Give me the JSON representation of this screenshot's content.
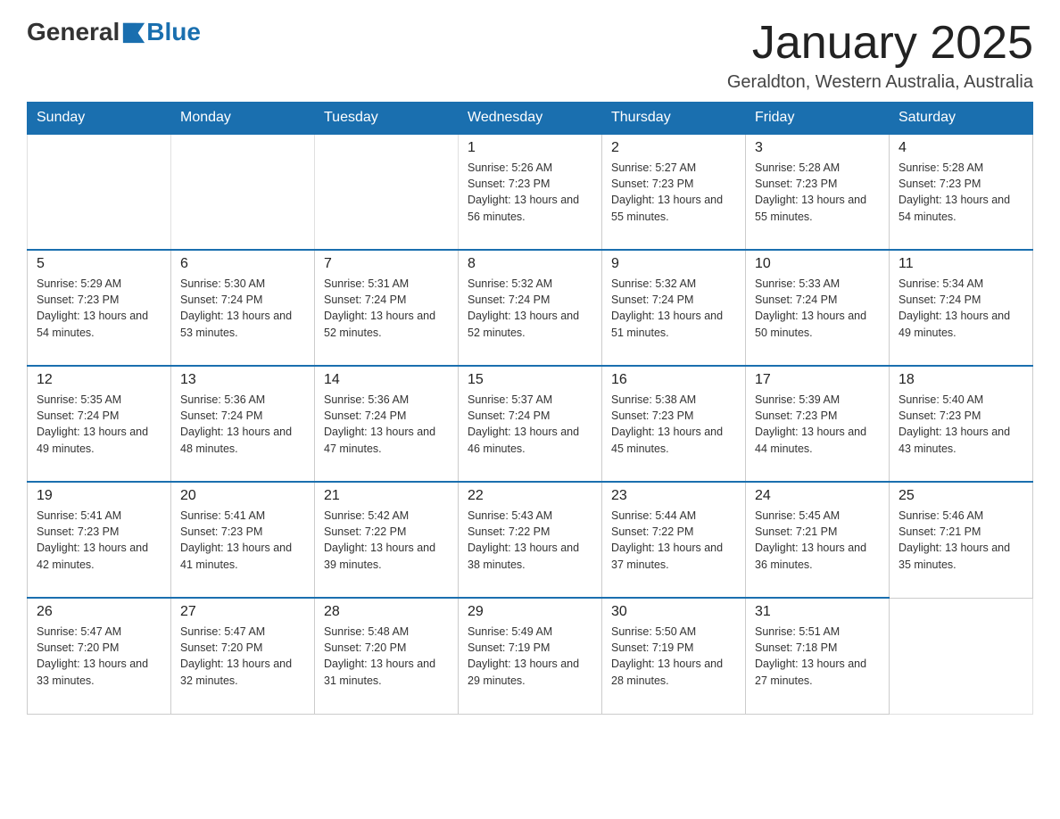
{
  "header": {
    "logo_general": "General",
    "logo_blue": "Blue",
    "title": "January 2025",
    "subtitle": "Geraldton, Western Australia, Australia"
  },
  "days_of_week": [
    "Sunday",
    "Monday",
    "Tuesday",
    "Wednesday",
    "Thursday",
    "Friday",
    "Saturday"
  ],
  "weeks": [
    {
      "days": [
        {
          "number": "",
          "info": ""
        },
        {
          "number": "",
          "info": ""
        },
        {
          "number": "",
          "info": ""
        },
        {
          "number": "1",
          "info": "Sunrise: 5:26 AM\nSunset: 7:23 PM\nDaylight: 13 hours and 56 minutes."
        },
        {
          "number": "2",
          "info": "Sunrise: 5:27 AM\nSunset: 7:23 PM\nDaylight: 13 hours and 55 minutes."
        },
        {
          "number": "3",
          "info": "Sunrise: 5:28 AM\nSunset: 7:23 PM\nDaylight: 13 hours and 55 minutes."
        },
        {
          "number": "4",
          "info": "Sunrise: 5:28 AM\nSunset: 7:23 PM\nDaylight: 13 hours and 54 minutes."
        }
      ]
    },
    {
      "days": [
        {
          "number": "5",
          "info": "Sunrise: 5:29 AM\nSunset: 7:23 PM\nDaylight: 13 hours and 54 minutes."
        },
        {
          "number": "6",
          "info": "Sunrise: 5:30 AM\nSunset: 7:24 PM\nDaylight: 13 hours and 53 minutes."
        },
        {
          "number": "7",
          "info": "Sunrise: 5:31 AM\nSunset: 7:24 PM\nDaylight: 13 hours and 52 minutes."
        },
        {
          "number": "8",
          "info": "Sunrise: 5:32 AM\nSunset: 7:24 PM\nDaylight: 13 hours and 52 minutes."
        },
        {
          "number": "9",
          "info": "Sunrise: 5:32 AM\nSunset: 7:24 PM\nDaylight: 13 hours and 51 minutes."
        },
        {
          "number": "10",
          "info": "Sunrise: 5:33 AM\nSunset: 7:24 PM\nDaylight: 13 hours and 50 minutes."
        },
        {
          "number": "11",
          "info": "Sunrise: 5:34 AM\nSunset: 7:24 PM\nDaylight: 13 hours and 49 minutes."
        }
      ]
    },
    {
      "days": [
        {
          "number": "12",
          "info": "Sunrise: 5:35 AM\nSunset: 7:24 PM\nDaylight: 13 hours and 49 minutes."
        },
        {
          "number": "13",
          "info": "Sunrise: 5:36 AM\nSunset: 7:24 PM\nDaylight: 13 hours and 48 minutes."
        },
        {
          "number": "14",
          "info": "Sunrise: 5:36 AM\nSunset: 7:24 PM\nDaylight: 13 hours and 47 minutes."
        },
        {
          "number": "15",
          "info": "Sunrise: 5:37 AM\nSunset: 7:24 PM\nDaylight: 13 hours and 46 minutes."
        },
        {
          "number": "16",
          "info": "Sunrise: 5:38 AM\nSunset: 7:23 PM\nDaylight: 13 hours and 45 minutes."
        },
        {
          "number": "17",
          "info": "Sunrise: 5:39 AM\nSunset: 7:23 PM\nDaylight: 13 hours and 44 minutes."
        },
        {
          "number": "18",
          "info": "Sunrise: 5:40 AM\nSunset: 7:23 PM\nDaylight: 13 hours and 43 minutes."
        }
      ]
    },
    {
      "days": [
        {
          "number": "19",
          "info": "Sunrise: 5:41 AM\nSunset: 7:23 PM\nDaylight: 13 hours and 42 minutes."
        },
        {
          "number": "20",
          "info": "Sunrise: 5:41 AM\nSunset: 7:23 PM\nDaylight: 13 hours and 41 minutes."
        },
        {
          "number": "21",
          "info": "Sunrise: 5:42 AM\nSunset: 7:22 PM\nDaylight: 13 hours and 39 minutes."
        },
        {
          "number": "22",
          "info": "Sunrise: 5:43 AM\nSunset: 7:22 PM\nDaylight: 13 hours and 38 minutes."
        },
        {
          "number": "23",
          "info": "Sunrise: 5:44 AM\nSunset: 7:22 PM\nDaylight: 13 hours and 37 minutes."
        },
        {
          "number": "24",
          "info": "Sunrise: 5:45 AM\nSunset: 7:21 PM\nDaylight: 13 hours and 36 minutes."
        },
        {
          "number": "25",
          "info": "Sunrise: 5:46 AM\nSunset: 7:21 PM\nDaylight: 13 hours and 35 minutes."
        }
      ]
    },
    {
      "days": [
        {
          "number": "26",
          "info": "Sunrise: 5:47 AM\nSunset: 7:20 PM\nDaylight: 13 hours and 33 minutes."
        },
        {
          "number": "27",
          "info": "Sunrise: 5:47 AM\nSunset: 7:20 PM\nDaylight: 13 hours and 32 minutes."
        },
        {
          "number": "28",
          "info": "Sunrise: 5:48 AM\nSunset: 7:20 PM\nDaylight: 13 hours and 31 minutes."
        },
        {
          "number": "29",
          "info": "Sunrise: 5:49 AM\nSunset: 7:19 PM\nDaylight: 13 hours and 29 minutes."
        },
        {
          "number": "30",
          "info": "Sunrise: 5:50 AM\nSunset: 7:19 PM\nDaylight: 13 hours and 28 minutes."
        },
        {
          "number": "31",
          "info": "Sunrise: 5:51 AM\nSunset: 7:18 PM\nDaylight: 13 hours and 27 minutes."
        },
        {
          "number": "",
          "info": ""
        }
      ]
    }
  ]
}
